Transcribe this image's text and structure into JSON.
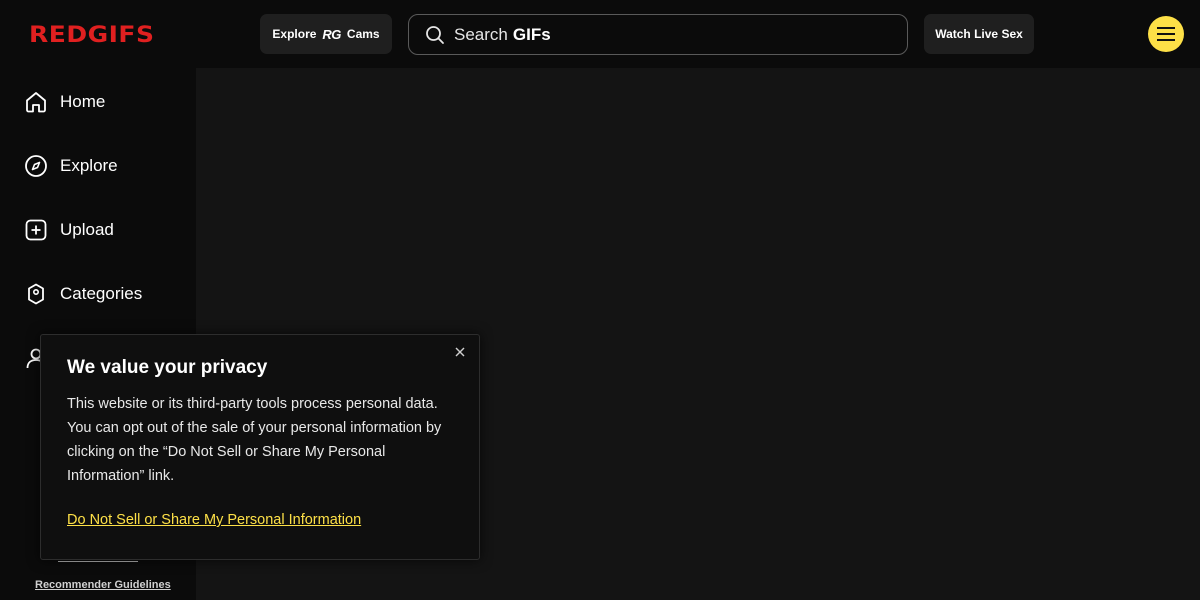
{
  "header": {
    "logo": "REDGIFS",
    "explore_label": "Explore",
    "rg_mark": "RG",
    "cams_label": "Cams",
    "search_prefix": "Search",
    "search_highlight": "GIFs",
    "watch_label": "Watch Live Sex",
    "menu_icon": "hamburger-icon"
  },
  "sidebar": {
    "items": [
      {
        "label": "Home",
        "icon": "home-icon"
      },
      {
        "label": "Explore",
        "icon": "compass-icon"
      },
      {
        "label": "Upload",
        "icon": "upload-plus-icon"
      },
      {
        "label": "Categories",
        "icon": "tag-icon"
      },
      {
        "label": "",
        "icon": "user-icon"
      }
    ],
    "footer_link": "Recommender Guidelines"
  },
  "consent": {
    "title": "We value your privacy",
    "body": "This website or its third-party tools process personal data. You can opt out of the sale of your personal information by clicking on the “Do Not Sell or Share My Personal Information” link.",
    "link": "Do Not Sell or Share My Personal Information",
    "close_icon": "close-icon"
  },
  "colors": {
    "brand": "#e02020",
    "accent": "#fde047",
    "background": "#0b0b0b",
    "content_bg": "#141414"
  }
}
